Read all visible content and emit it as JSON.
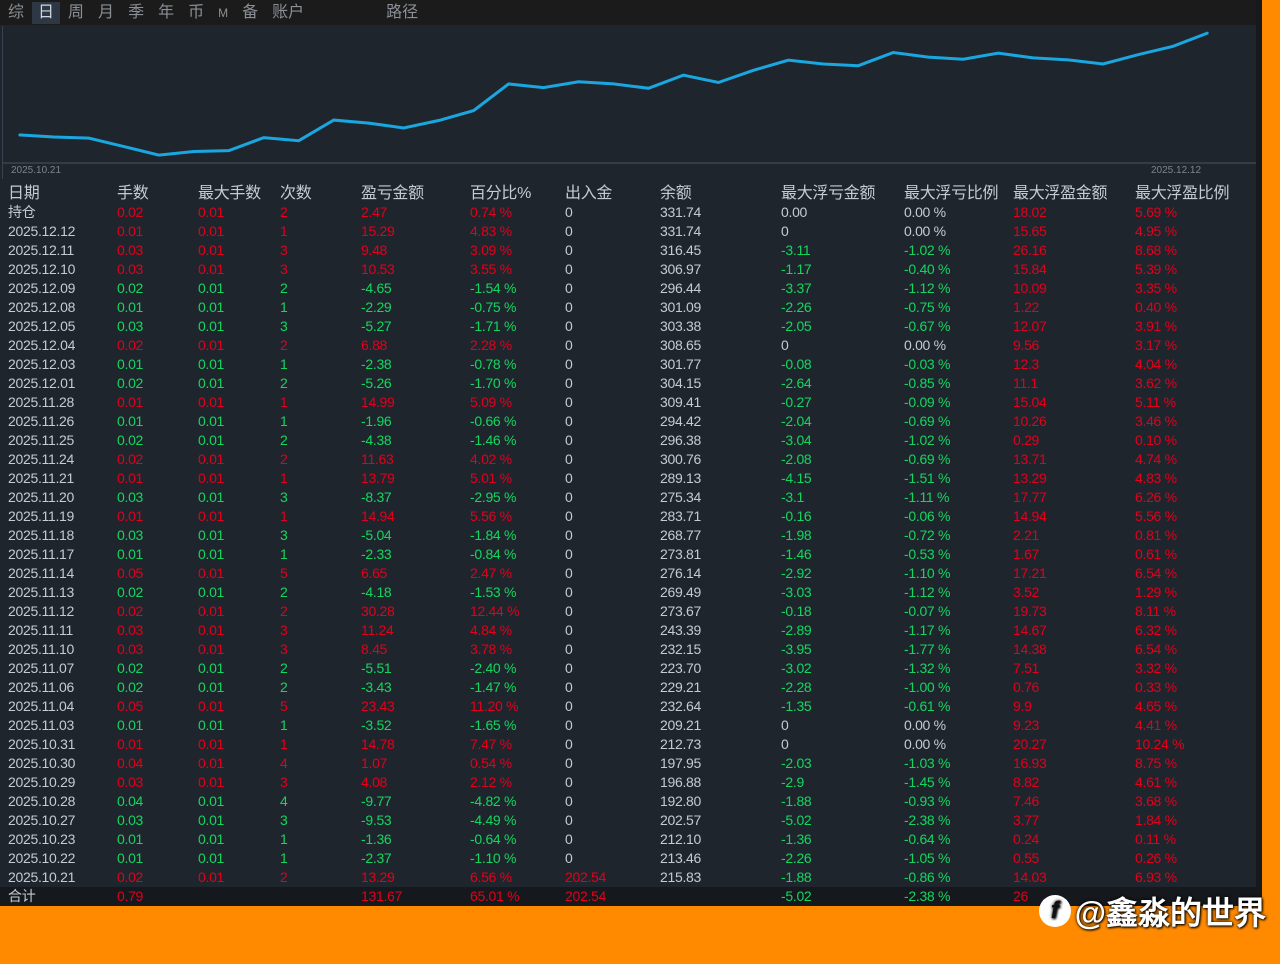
{
  "topbar": {
    "tabs": [
      "综",
      "日",
      "周",
      "月",
      "季",
      "年",
      "币",
      "M",
      "备",
      "账户"
    ],
    "active": 1,
    "path_label": "路径"
  },
  "colors": {
    "profit": "#e2001b",
    "loss": "#14d65e",
    "line": "#1aa7e0",
    "accent": "#ff8a00"
  },
  "chart_data": {
    "type": "line",
    "x_start_label": "2025.10.21",
    "x_end_label": "2025.12.12",
    "x": [
      "2025.10.21",
      "2025.10.22",
      "2025.10.23",
      "2025.10.27",
      "2025.10.28",
      "2025.10.29",
      "2025.10.30",
      "2025.10.31",
      "2025.11.03",
      "2025.11.04",
      "2025.11.06",
      "2025.11.07",
      "2025.11.10",
      "2025.11.11",
      "2025.11.12",
      "2025.11.13",
      "2025.11.14",
      "2025.11.17",
      "2025.11.18",
      "2025.11.19",
      "2025.11.20",
      "2025.11.21",
      "2025.11.24",
      "2025.11.25",
      "2025.11.26",
      "2025.11.28",
      "2025.12.01",
      "2025.12.03",
      "2025.12.04",
      "2025.12.05",
      "2025.12.08",
      "2025.12.09",
      "2025.12.10",
      "2025.12.11",
      "2025.12.12"
    ],
    "series": [
      {
        "name": "余额",
        "values": [
          215.83,
          213.46,
          212.1,
          202.57,
          192.8,
          196.88,
          197.95,
          212.73,
          209.21,
          232.64,
          229.21,
          223.7,
          232.15,
          243.39,
          273.67,
          269.49,
          276.14,
          273.81,
          268.77,
          283.71,
          275.34,
          289.13,
          300.76,
          296.38,
          294.42,
          309.41,
          304.15,
          301.77,
          308.65,
          303.38,
          301.09,
          296.44,
          306.97,
          316.45,
          331.74
        ]
      }
    ],
    "ylim": [
      185,
      335
    ],
    "grid": false
  },
  "table": {
    "headers": [
      "日期",
      "手数",
      "最大手数",
      "次数",
      "盈亏金额",
      "百分比%",
      "出入金",
      "余额",
      "最大浮亏金额",
      "最大浮亏比例",
      "最大浮盈金额",
      "最大浮盈比例"
    ],
    "rows": [
      [
        "持仓",
        "0.02",
        "0.01",
        "2",
        "2.47",
        "0.74 %",
        "0",
        "331.74",
        "0.00",
        "0.00 %",
        "18.02",
        "5.69 %"
      ],
      [
        "2025.12.12",
        "0.01",
        "0.01",
        "1",
        "15.29",
        "4.83 %",
        "0",
        "331.74",
        "0",
        "0.00 %",
        "15.65",
        "4.95 %"
      ],
      [
        "2025.12.11",
        "0.03",
        "0.01",
        "3",
        "9.48",
        "3.09 %",
        "0",
        "316.45",
        "-3.11",
        "-1.02 %",
        "26.16",
        "8.68 %"
      ],
      [
        "2025.12.10",
        "0.03",
        "0.01",
        "3",
        "10.53",
        "3.55 %",
        "0",
        "306.97",
        "-1.17",
        "-0.40 %",
        "15.84",
        "5.39 %"
      ],
      [
        "2025.12.09",
        "0.02",
        "0.01",
        "2",
        "-4.65",
        "-1.54 %",
        "0",
        "296.44",
        "-3.37",
        "-1.12 %",
        "10.09",
        "3.35 %"
      ],
      [
        "2025.12.08",
        "0.01",
        "0.01",
        "1",
        "-2.29",
        "-0.75 %",
        "0",
        "301.09",
        "-2.26",
        "-0.75 %",
        "1.22",
        "0.40 %"
      ],
      [
        "2025.12.05",
        "0.03",
        "0.01",
        "3",
        "-5.27",
        "-1.71 %",
        "0",
        "303.38",
        "-2.05",
        "-0.67 %",
        "12.07",
        "3.91 %"
      ],
      [
        "2025.12.04",
        "0.02",
        "0.01",
        "2",
        "6.88",
        "2.28 %",
        "0",
        "308.65",
        "0",
        "0.00 %",
        "9.56",
        "3.17 %"
      ],
      [
        "2025.12.03",
        "0.01",
        "0.01",
        "1",
        "-2.38",
        "-0.78 %",
        "0",
        "301.77",
        "-0.08",
        "-0.03 %",
        "12.3",
        "4.04 %"
      ],
      [
        "2025.12.01",
        "0.02",
        "0.01",
        "2",
        "-5.26",
        "-1.70 %",
        "0",
        "304.15",
        "-2.64",
        "-0.85 %",
        "11.1",
        "3.62 %"
      ],
      [
        "2025.11.28",
        "0.01",
        "0.01",
        "1",
        "14.99",
        "5.09 %",
        "0",
        "309.41",
        "-0.27",
        "-0.09 %",
        "15.04",
        "5.11 %"
      ],
      [
        "2025.11.26",
        "0.01",
        "0.01",
        "1",
        "-1.96",
        "-0.66 %",
        "0",
        "294.42",
        "-2.04",
        "-0.69 %",
        "10.26",
        "3.46 %"
      ],
      [
        "2025.11.25",
        "0.02",
        "0.01",
        "2",
        "-4.38",
        "-1.46 %",
        "0",
        "296.38",
        "-3.04",
        "-1.02 %",
        "0.29",
        "0.10 %"
      ],
      [
        "2025.11.24",
        "0.02",
        "0.01",
        "2",
        "11.63",
        "4.02 %",
        "0",
        "300.76",
        "-2.08",
        "-0.69 %",
        "13.71",
        "4.74 %"
      ],
      [
        "2025.11.21",
        "0.01",
        "0.01",
        "1",
        "13.79",
        "5.01 %",
        "0",
        "289.13",
        "-4.15",
        "-1.51 %",
        "13.29",
        "4.83 %"
      ],
      [
        "2025.11.20",
        "0.03",
        "0.01",
        "3",
        "-8.37",
        "-2.95 %",
        "0",
        "275.34",
        "-3.1",
        "-1.11 %",
        "17.77",
        "6.26 %"
      ],
      [
        "2025.11.19",
        "0.01",
        "0.01",
        "1",
        "14.94",
        "5.56 %",
        "0",
        "283.71",
        "-0.16",
        "-0.06 %",
        "14.94",
        "5.56 %"
      ],
      [
        "2025.11.18",
        "0.03",
        "0.01",
        "3",
        "-5.04",
        "-1.84 %",
        "0",
        "268.77",
        "-1.98",
        "-0.72 %",
        "2.21",
        "0.81 %"
      ],
      [
        "2025.11.17",
        "0.01",
        "0.01",
        "1",
        "-2.33",
        "-0.84 %",
        "0",
        "273.81",
        "-1.46",
        "-0.53 %",
        "1.67",
        "0.61 %"
      ],
      [
        "2025.11.14",
        "0.05",
        "0.01",
        "5",
        "6.65",
        "2.47 %",
        "0",
        "276.14",
        "-2.92",
        "-1.10 %",
        "17.21",
        "6.54 %"
      ],
      [
        "2025.11.13",
        "0.02",
        "0.01",
        "2",
        "-4.18",
        "-1.53 %",
        "0",
        "269.49",
        "-3.03",
        "-1.12 %",
        "3.52",
        "1.29 %"
      ],
      [
        "2025.11.12",
        "0.02",
        "0.01",
        "2",
        "30.28",
        "12.44 %",
        "0",
        "273.67",
        "-0.18",
        "-0.07 %",
        "19.73",
        "8.11 %"
      ],
      [
        "2025.11.11",
        "0.03",
        "0.01",
        "3",
        "11.24",
        "4.84 %",
        "0",
        "243.39",
        "-2.89",
        "-1.17 %",
        "14.67",
        "6.32 %"
      ],
      [
        "2025.11.10",
        "0.03",
        "0.01",
        "3",
        "8.45",
        "3.78 %",
        "0",
        "232.15",
        "-3.95",
        "-1.77 %",
        "14.38",
        "6.54 %"
      ],
      [
        "2025.11.07",
        "0.02",
        "0.01",
        "2",
        "-5.51",
        "-2.40 %",
        "0",
        "223.70",
        "-3.02",
        "-1.32 %",
        "7.51",
        "3.32 %"
      ],
      [
        "2025.11.06",
        "0.02",
        "0.01",
        "2",
        "-3.43",
        "-1.47 %",
        "0",
        "229.21",
        "-2.28",
        "-1.00 %",
        "0.76",
        "0.33 %"
      ],
      [
        "2025.11.04",
        "0.05",
        "0.01",
        "5",
        "23.43",
        "11.20 %",
        "0",
        "232.64",
        "-1.35",
        "-0.61 %",
        "9.9",
        "4.65 %"
      ],
      [
        "2025.11.03",
        "0.01",
        "0.01",
        "1",
        "-3.52",
        "-1.65 %",
        "0",
        "209.21",
        "0",
        "0.00 %",
        "9.23",
        "4.41 %"
      ],
      [
        "2025.10.31",
        "0.01",
        "0.01",
        "1",
        "14.78",
        "7.47 %",
        "0",
        "212.73",
        "0",
        "0.00 %",
        "20.27",
        "10.24 %"
      ],
      [
        "2025.10.30",
        "0.04",
        "0.01",
        "4",
        "1.07",
        "0.54 %",
        "0",
        "197.95",
        "-2.03",
        "-1.03 %",
        "16.93",
        "8.75 %"
      ],
      [
        "2025.10.29",
        "0.03",
        "0.01",
        "3",
        "4.08",
        "2.12 %",
        "0",
        "196.88",
        "-2.9",
        "-1.45 %",
        "8.82",
        "4.61 %"
      ],
      [
        "2025.10.28",
        "0.04",
        "0.01",
        "4",
        "-9.77",
        "-4.82 %",
        "0",
        "192.80",
        "-1.88",
        "-0.93 %",
        "7.46",
        "3.68 %"
      ],
      [
        "2025.10.27",
        "0.03",
        "0.01",
        "3",
        "-9.53",
        "-4.49 %",
        "0",
        "202.57",
        "-5.02",
        "-2.38 %",
        "3.77",
        "1.84 %"
      ],
      [
        "2025.10.23",
        "0.01",
        "0.01",
        "1",
        "-1.36",
        "-0.64 %",
        "0",
        "212.10",
        "-1.36",
        "-0.64 %",
        "0.24",
        "0.11 %"
      ],
      [
        "2025.10.22",
        "0.01",
        "0.01",
        "1",
        "-2.37",
        "-1.10 %",
        "0",
        "213.46",
        "-2.26",
        "-1.05 %",
        "0.55",
        "0.26 %"
      ],
      [
        "2025.10.21",
        "0.02",
        "0.01",
        "2",
        "13.29",
        "6.56 %",
        "202.54",
        "215.83",
        "-1.88",
        "-0.86 %",
        "14.03",
        "6.93 %"
      ]
    ],
    "total": [
      "合计",
      "0.79",
      "",
      "",
      "131.67",
      "65.01 %",
      "202.54",
      "",
      "-5.02",
      "-2.38 %",
      "26",
      ""
    ]
  },
  "watermark": {
    "text": "@鑫淼的世界"
  }
}
